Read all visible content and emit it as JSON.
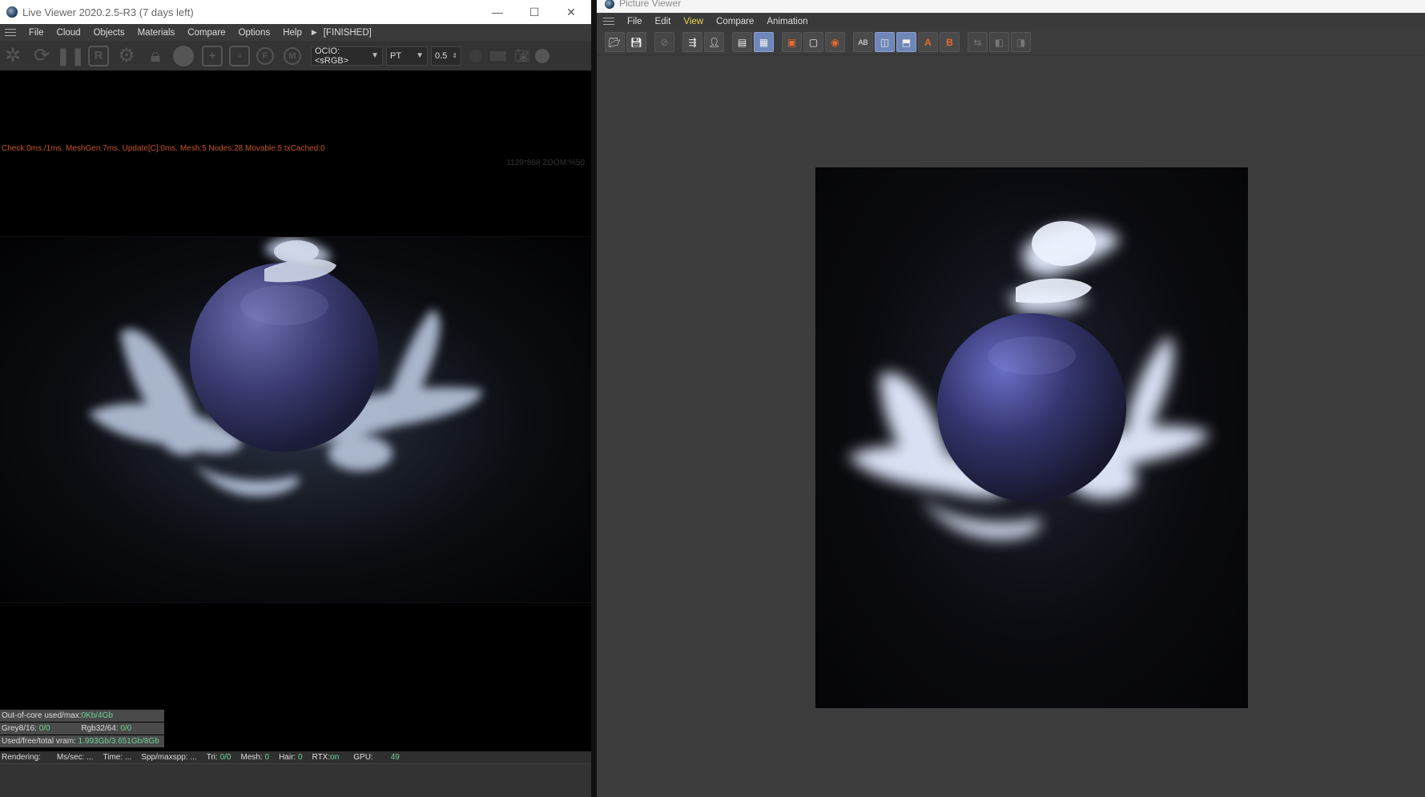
{
  "live_viewer": {
    "title": "Live Viewer 2020.2.5-R3 (7 days left)",
    "window_controls": {
      "minimize": "—",
      "maximize": "☐",
      "close": "✕"
    },
    "menu": [
      "File",
      "Cloud",
      "Objects",
      "Materials",
      "Compare",
      "Options",
      "Help"
    ],
    "status_flag": "[FINISHED]",
    "toolbar": {
      "ocio_select": "OCIO:<sRGB>",
      "mode_select": "PT",
      "value_field": "0.5",
      "icons": [
        "send-icon",
        "refresh-icon",
        "pause-icon",
        "region-icon",
        "settings-icon",
        "lock-icon",
        "sphere-icon",
        "add-box-icon",
        "clay-icon",
        "focus-icon",
        "material-icon",
        "ocio-icon"
      ]
    },
    "stats_line": "Check:0ms./1ms. MeshGen:7ms. Update[C]:0ms. Mesh:5 Nodes:28 Movable:5 txCached:0",
    "zoom_line": "1129*868 ZOOM:%50",
    "info": {
      "out_of_core_label": "Out-of-core used/max:",
      "out_of_core_value": "0Kb/4Gb",
      "grey_label": "Grey8/16:",
      "grey_value": "0/0",
      "rgb_label": "Rgb32/64:",
      "rgb_value": "0/0",
      "vram_label": "Used/free/total vram:",
      "vram_value": "1.993Gb/3.651Gb/8Gb"
    },
    "statusbar": {
      "rendering": "Rendering:",
      "ms_sec": "Ms/sec: ...",
      "time": "Time: ...",
      "spp": "Spp/maxspp: ...",
      "tri_label": "Tri:",
      "tri_value": "0/0",
      "mesh_label": "Mesh:",
      "mesh_value": "0",
      "hair_label": "Hair:",
      "hair_value": "0",
      "rtx_label": "RTX:",
      "rtx_value": "on",
      "gpu_label": "GPU:",
      "gpu_value": "49"
    }
  },
  "picture_viewer": {
    "title": "Picture Viewer",
    "menu": [
      "File",
      "Edit",
      "View",
      "Compare",
      "Animation"
    ],
    "active_menu": "View",
    "toolbar_labels": {
      "a": "A",
      "b": "B"
    }
  }
}
